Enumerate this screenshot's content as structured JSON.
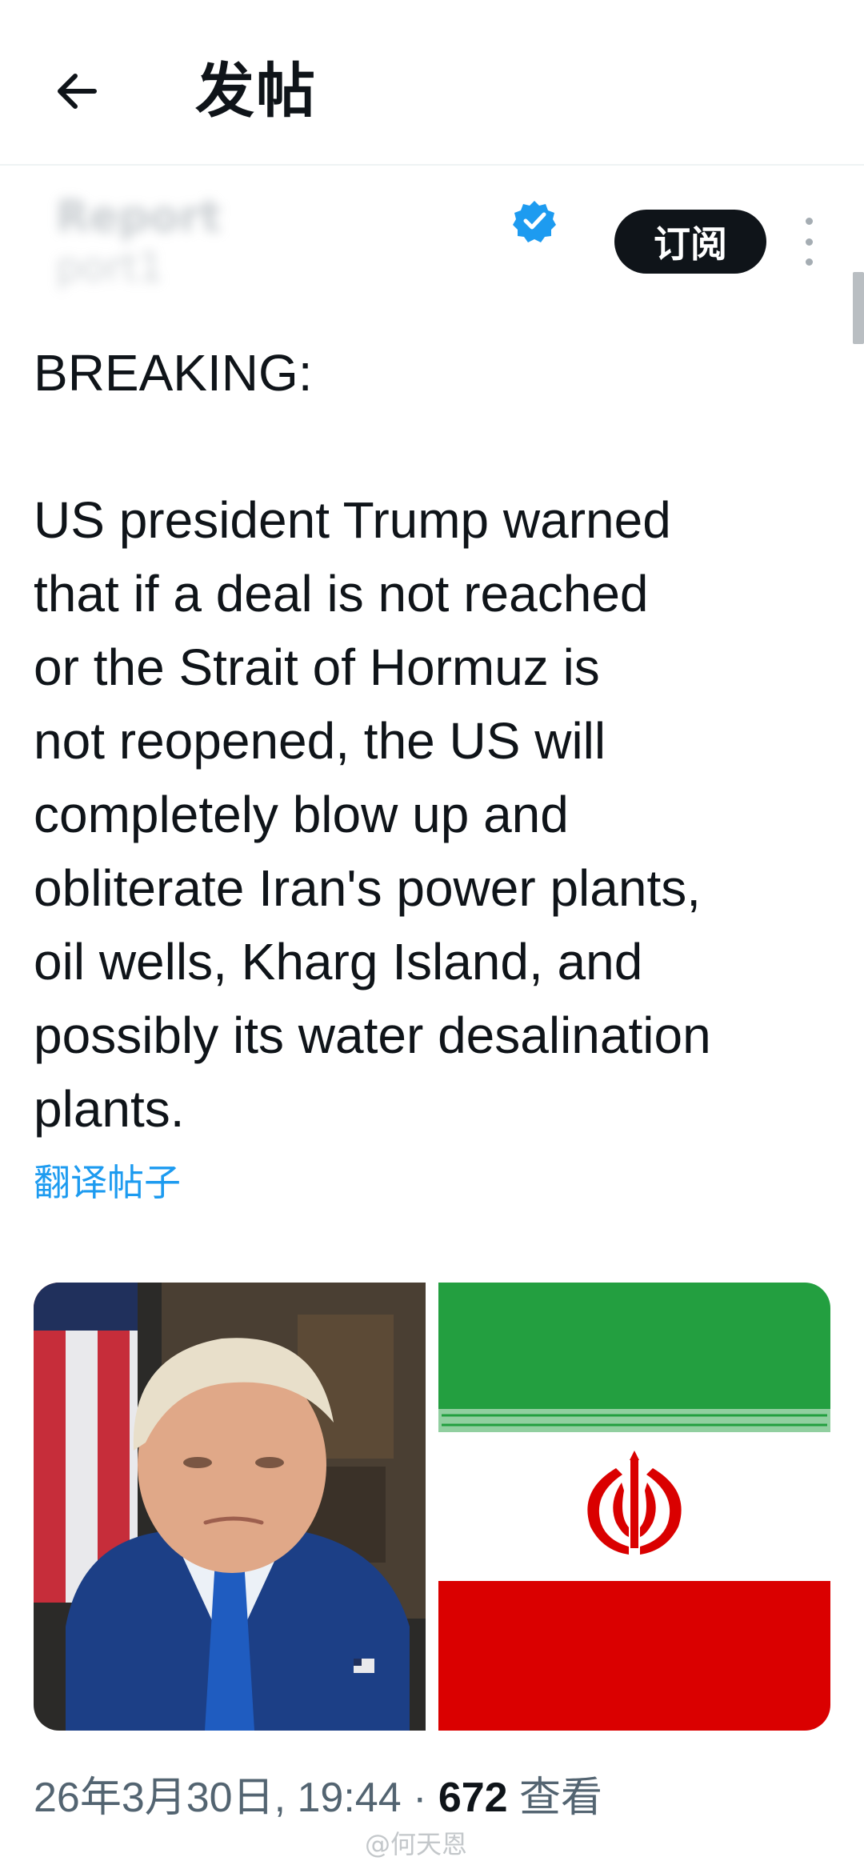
{
  "header": {
    "title": "发帖"
  },
  "author": {
    "name": "Report",
    "handle": "port1"
  },
  "actions": {
    "subscribe_label": "订阅"
  },
  "tweet": {
    "text": "BREAKING:\n\nUS president Trump warned\nthat if a deal is not reached\nor the Strait of Hormuz is\nnot reopened, the US will\ncompletely blow up and\nobliterate Iran's power plants,\noil wells, Kharg Island, and\npossibly its water desalination\nplants.",
    "translate_label": "翻译帖子"
  },
  "meta": {
    "datetime": "26年3月30日, 19:44 · ",
    "views_count": "672",
    "views_label": " 查看"
  },
  "watermark": "@何天恩",
  "colors": {
    "accent": "#1d9bf0",
    "flag_green": "#239f40",
    "flag_red": "#da0000"
  },
  "icons": [
    "back-arrow-icon",
    "verified-badge-icon",
    "more-vertical-icon"
  ]
}
